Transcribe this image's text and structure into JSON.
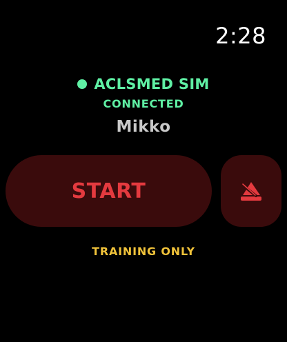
{
  "status_bar": {
    "time": "2:28"
  },
  "device": {
    "name": "ACLSMED SIM",
    "status": "CONNECTED",
    "status_color": "#5ff0a4"
  },
  "user": {
    "name": "Mikko"
  },
  "actions": {
    "start_label": "START",
    "alert_icon": "alarm-off-icon",
    "button_color": "#3a0b0c",
    "accent_color": "#e43a3f"
  },
  "footer": {
    "note": "TRAINING ONLY",
    "note_color": "#f0c23a"
  }
}
